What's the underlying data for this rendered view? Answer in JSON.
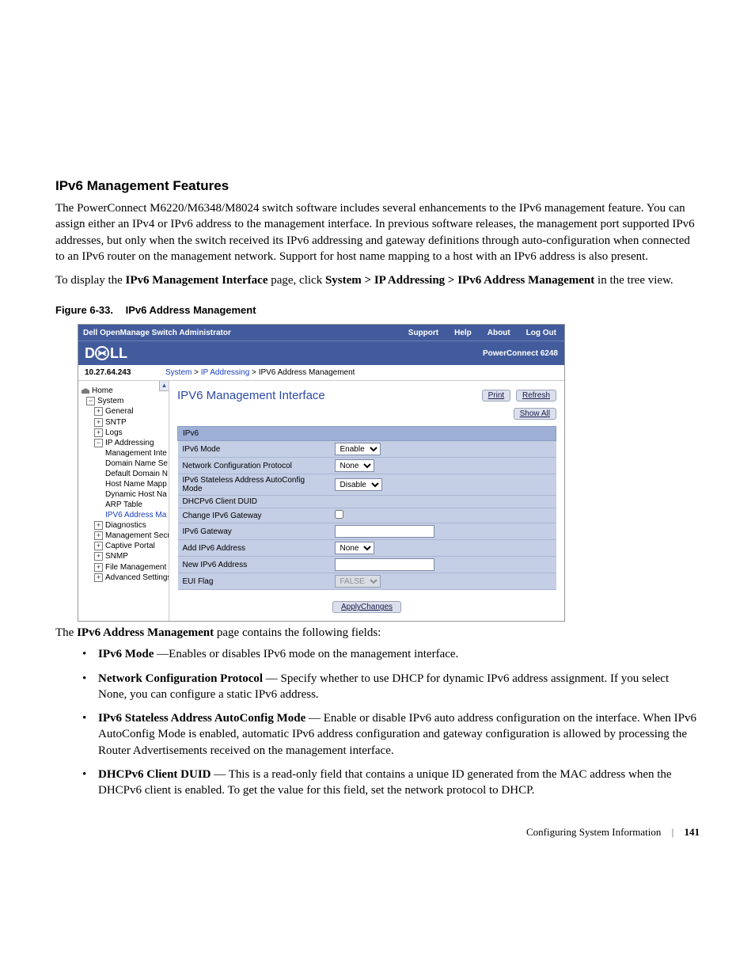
{
  "heading": "IPv6 Management Features",
  "para1": "The PowerConnect M6220/M6348/M8024 switch software includes several enhancements to the IPv6 management feature. You can assign either an IPv4 or IPv6 address to the management interface. In previous software releases, the management port supported IPv6 addresses, but only when the switch received its IPv6 addressing and gateway definitions through auto-configuration when connected to an IPv6 router on the management network. Support for host name mapping to a host with an IPv6 address is also present.",
  "para2_pre": "To display the ",
  "para2_b1": "IPv6 Management Interface",
  "para2_mid": " page, click ",
  "para2_b2": "System > IP Addressing > IPv6 Address Management",
  "para2_post": " in the tree view.",
  "fig_num": "Figure 6-33.",
  "fig_title": "IPv6 Address Management",
  "app": {
    "title": "Dell OpenManage Switch Administrator",
    "links": {
      "support": "Support",
      "help": "Help",
      "about": "About",
      "logout": "Log Out"
    },
    "product": "PowerConnect 6248",
    "ip": "10.27.64.243",
    "trail_a": "System",
    "trail_b": "IP Addressing",
    "trail_c": "IPV6 Address Management",
    "tree": {
      "home": "Home",
      "system": "System",
      "general": "General",
      "sntp": "SNTP",
      "logs": "Logs",
      "ipaddr": "IP Addressing",
      "mgmtint": "Management Inte",
      "dns": "Domain Name Se",
      "defdom": "Default Domain N",
      "hostmap": "Host Name Mapp",
      "dynhost": "Dynamic Host Na",
      "arp": "ARP Table",
      "ipv6am": "IPV6 Address Ma",
      "diag": "Diagnostics",
      "msec": "Management Secur",
      "captive": "Captive Portal",
      "snmp": "SNMP",
      "filemgmt": "File Management",
      "adv": "Advanced Settings"
    },
    "page_title": "IPV6 Management Interface",
    "btn_print": "Print",
    "btn_refresh": "Refresh",
    "btn_showall": "Show All",
    "btn_apply": "ApplyChanges",
    "group": "IPv6",
    "rows": {
      "r1": "IPv6 Mode",
      "r2": "Network Configuration Protocol",
      "r3": "IPv6 Stateless Address AutoConfig Mode",
      "r4": "DHCPv6 Client DUID",
      "r5": "Change IPv6 Gateway",
      "r6": "IPv6 Gateway",
      "r7": "Add IPv6 Address",
      "r8": "New IPv6 Address",
      "r9": "EUI Flag"
    },
    "vals": {
      "mode": "Enable",
      "proto": "None",
      "auto": "Disable",
      "add": "None",
      "eui": "FALSE"
    }
  },
  "intro_line_pre": "The ",
  "intro_line_b": "IPv6 Address Management",
  "intro_line_post": " page contains the following fields:",
  "fields": {
    "f1b": "IPv6 Mode ",
    "f1t": "—Enables or disables IPv6 mode on the management interface.",
    "f2b": "Network Configuration Protocol ",
    "f2t": "— Specify whether to use DHCP for dynamic IPv6 address assignment. If you select None, you can configure a static IPv6 address.",
    "f3b": "IPv6 Stateless Address AutoConfig Mode ",
    "f3t": "— Enable or disable IPv6 auto address configuration on the interface. When IPv6 AutoConfig Mode is enabled, automatic IPv6 address configuration and gateway configuration is allowed by processing the Router Advertisements received on the management interface.",
    "f4b": "DHCPv6 Client DUID ",
    "f4t": "— This is a read-only field that contains a unique ID generated from the MAC address when the DHCPv6 client is enabled. To get the value for this field, set the network protocol to DHCP."
  },
  "footer_section": "Configuring System Information",
  "footer_page": "141"
}
